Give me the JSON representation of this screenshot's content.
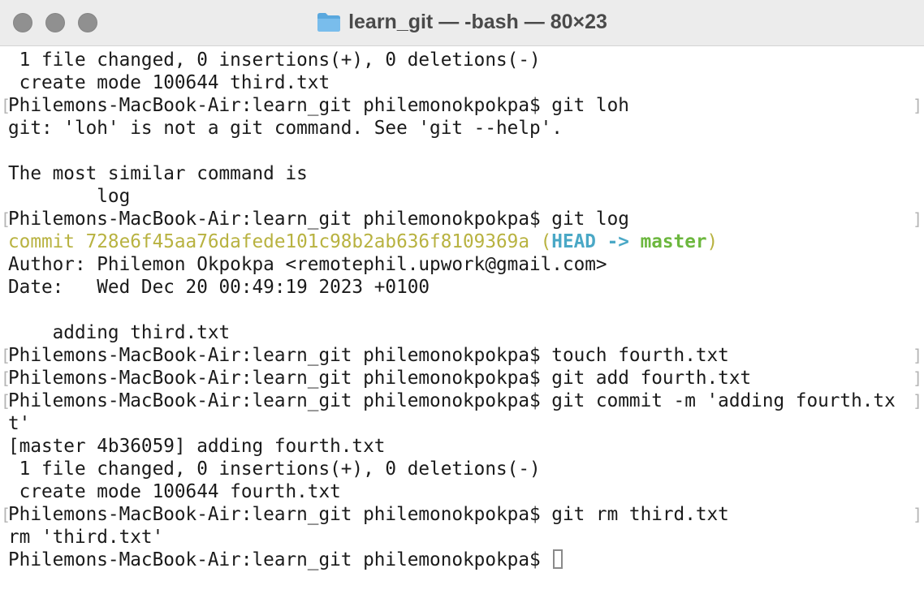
{
  "window": {
    "title": "learn_git — -bash — 80×23",
    "folder_icon": "folder-icon",
    "colors": {
      "titlebar_bg": "#ececec",
      "traffic_light": "#909090",
      "text": "#1a1a1a",
      "commit_hash": "#b8b240",
      "ref_head": "#4aa8c6",
      "ref_branch": "#6cb73e"
    }
  },
  "terminal": {
    "lines": [
      " 1 file changed, 0 insertions(+), 0 deletions(-)",
      " create mode 100644 third.txt",
      "Philemons-MacBook-Air:learn_git philemonokpokpa$ git loh",
      "git: 'loh' is not a git command. See 'git --help'.",
      "",
      "The most similar command is",
      "        log",
      "Philemons-MacBook-Air:learn_git philemonokpokpa$ git log",
      "Author: Philemon Okpokpa <remotephil.upwork@gmail.com>",
      "Date:   Wed Dec 20 00:49:19 2023 +0100",
      "",
      "    adding third.txt",
      "Philemons-MacBook-Air:learn_git philemonokpokpa$ touch fourth.txt",
      "Philemons-MacBook-Air:learn_git philemonokpokpa$ git add fourth.txt",
      "Philemons-MacBook-Air:learn_git philemonokpokpa$ git commit -m 'adding fourth.tx",
      "t'",
      "[master 4b36059] adding fourth.txt",
      " 1 file changed, 0 insertions(+), 0 deletions(-)",
      " create mode 100644 fourth.txt",
      "Philemons-MacBook-Air:learn_git philemonokpokpa$ git rm third.txt",
      "rm 'third.txt'",
      "Philemons-MacBook-Air:learn_git philemonokpokpa$ "
    ],
    "commit": {
      "prefix": "commit 728e6f45aa76dafede101c98b2ab636f8109369a (",
      "head": "HEAD",
      "arrow": " -> ",
      "branch": "master",
      "suffix": ")"
    }
  }
}
